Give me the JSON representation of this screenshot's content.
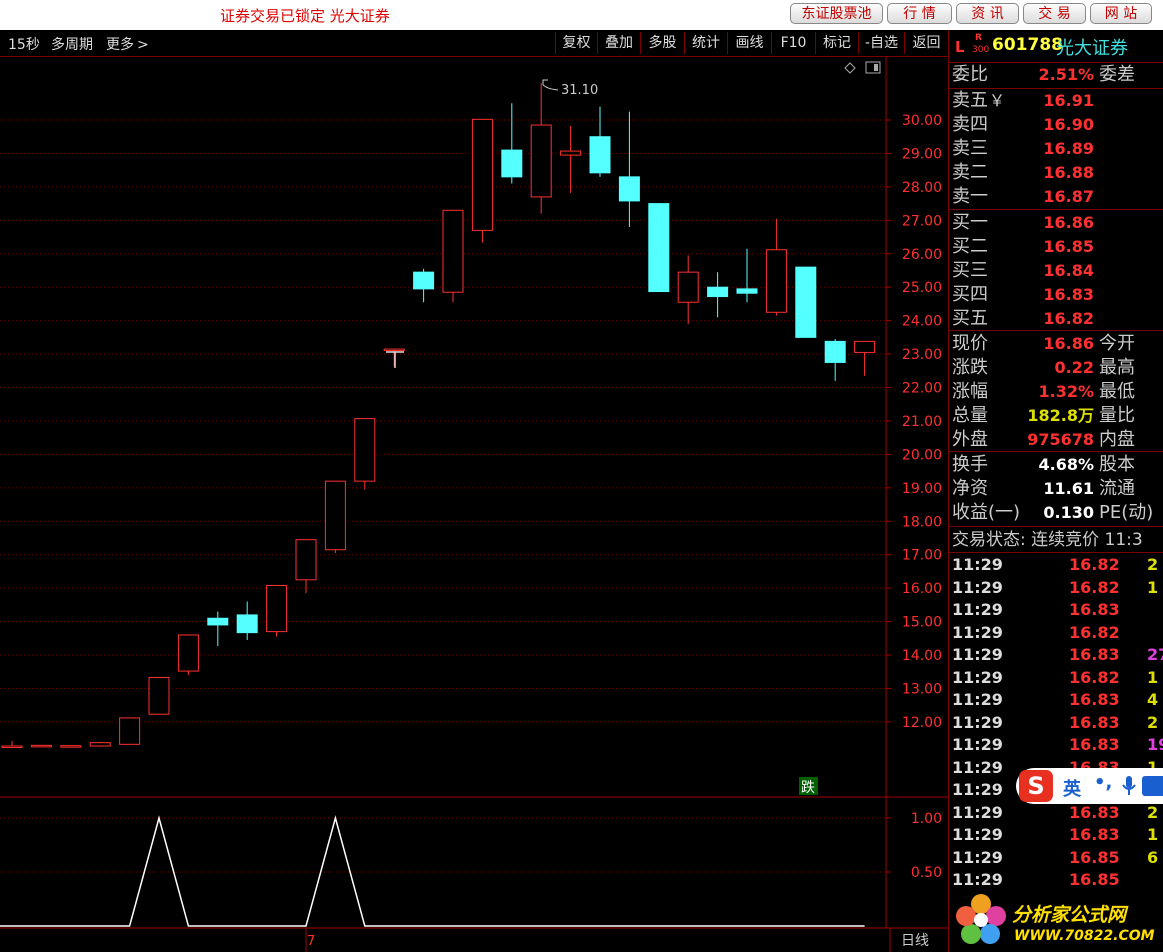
{
  "topbar": {
    "lock_message": "证券交易已锁定  光大证券",
    "buttons": [
      "东证股票池",
      "行 情",
      "资 讯",
      "交 易",
      "网 站"
    ]
  },
  "toolbar": {
    "period": "15秒",
    "multi_period": "多周期",
    "more": "更多",
    "buttons": [
      "复权",
      "叠加",
      "多股",
      "统计",
      "画线",
      "F10",
      "标记",
      "-自选",
      "返回"
    ]
  },
  "chart": {
    "high_marker": "31.10",
    "signal_label": "跌",
    "bottom_tab": "日线",
    "bottom_axis_label": "7"
  },
  "chart_data": [
    {
      "type": "candlestick",
      "y_ticks": [
        "30.00",
        "29.00",
        "28.00",
        "27.00",
        "26.00",
        "25.00",
        "24.00",
        "23.00",
        "22.00",
        "21.00",
        "20.00",
        "19.00",
        "18.00",
        "17.00",
        "16.00",
        "15.00",
        "14.00",
        "13.00",
        "12.00"
      ],
      "y_tick_values": [
        30,
        29,
        28,
        27,
        26,
        25,
        24,
        23,
        22,
        21,
        20,
        19,
        18,
        17,
        16,
        15,
        14,
        13,
        12
      ],
      "colors": {
        "up": "#ff3030",
        "down": "#54ffff"
      },
      "candles": [
        {
          "o": 11.28,
          "h": 11.43,
          "l": 11.28,
          "c": 11.28
        },
        {
          "o": 11.3,
          "h": 11.3,
          "l": 11.3,
          "c": 11.3
        },
        {
          "o": 11.29,
          "h": 11.29,
          "l": 11.29,
          "c": 11.29
        },
        {
          "o": 11.28,
          "h": 11.4,
          "l": 11.28,
          "c": 11.38
        },
        {
          "o": 11.33,
          "h": 12.12,
          "l": 11.33,
          "c": 12.12
        },
        {
          "o": 12.23,
          "h": 13.33,
          "l": 12.23,
          "c": 13.33
        },
        {
          "o": 13.52,
          "h": 14.6,
          "l": 13.4,
          "c": 14.6
        },
        {
          "o": 15.1,
          "h": 15.3,
          "l": 14.27,
          "c": 14.9
        },
        {
          "o": 15.2,
          "h": 15.6,
          "l": 14.45,
          "c": 14.67
        },
        {
          "o": 14.7,
          "h": 16.08,
          "l": 14.55,
          "c": 16.08
        },
        {
          "o": 16.25,
          "h": 17.45,
          "l": 15.85,
          "c": 17.45
        },
        {
          "o": 17.15,
          "h": 19.2,
          "l": 17.05,
          "c": 19.2
        },
        {
          "o": 19.2,
          "h": 21.07,
          "l": 18.95,
          "c": 21.07
        },
        {
          "o": 23.15,
          "h": 23.15,
          "l": 22.63,
          "c": 23.15
        },
        {
          "o": 25.45,
          "h": 25.55,
          "l": 24.55,
          "c": 24.95
        },
        {
          "o": 24.85,
          "h": 27.3,
          "l": 24.55,
          "c": 27.3
        },
        {
          "o": 26.7,
          "h": 30.02,
          "l": 26.33,
          "c": 30.02
        },
        {
          "o": 29.1,
          "h": 30.5,
          "l": 28.1,
          "c": 28.3
        },
        {
          "o": 27.7,
          "h": 31.1,
          "l": 27.2,
          "c": 29.85
        },
        {
          "o": 28.95,
          "h": 29.82,
          "l": 27.82,
          "c": 29.07
        },
        {
          "o": 29.5,
          "h": 30.4,
          "l": 28.3,
          "c": 28.42
        },
        {
          "o": 28.3,
          "h": 30.25,
          "l": 26.8,
          "c": 27.58
        },
        {
          "o": 27.5,
          "h": 27.5,
          "l": 24.87,
          "c": 24.87
        },
        {
          "o": 24.55,
          "h": 25.95,
          "l": 23.9,
          "c": 25.45
        },
        {
          "o": 25.0,
          "h": 25.45,
          "l": 24.1,
          "c": 24.72
        },
        {
          "o": 24.95,
          "h": 26.15,
          "l": 24.55,
          "c": 24.82
        },
        {
          "o": 24.25,
          "h": 27.05,
          "l": 24.15,
          "c": 26.12
        },
        {
          "o": 25.6,
          "h": 25.6,
          "l": 23.5,
          "c": 23.5
        },
        {
          "o": 23.38,
          "h": 23.45,
          "l": 22.2,
          "c": 22.75
        },
        {
          "o": 23.05,
          "h": 23.38,
          "l": 22.35,
          "c": 23.38
        }
      ]
    },
    {
      "type": "line",
      "y_ticks": [
        "1.00",
        "0.50"
      ],
      "y_tick_values": [
        1.0,
        0.5
      ],
      "series": [
        {
          "points": [
            [
              0,
              0
            ],
            [
              4,
              0
            ],
            [
              5,
              1
            ],
            [
              6,
              0
            ],
            [
              10,
              0
            ],
            [
              11,
              1
            ],
            [
              12,
              0
            ],
            [
              29,
              0
            ]
          ]
        }
      ]
    }
  ],
  "quote": {
    "badge_l": "L",
    "badge_r": "R",
    "badge_300": "300",
    "code": "601788",
    "name": "光大证券",
    "weibi_label": "委比",
    "weibi_value": "2.51%",
    "weicha_label": "委差",
    "sell": [
      {
        "label": "卖五",
        "price": "16.91"
      },
      {
        "label": "卖四",
        "price": "16.90"
      },
      {
        "label": "卖三",
        "price": "16.89"
      },
      {
        "label": "卖二",
        "price": "16.88"
      },
      {
        "label": "卖一",
        "price": "16.87"
      }
    ],
    "sell5_mark": "￥",
    "buy": [
      {
        "label": "买一",
        "price": "16.86"
      },
      {
        "label": "买二",
        "price": "16.85"
      },
      {
        "label": "买三",
        "price": "16.84"
      },
      {
        "label": "买四",
        "price": "16.83"
      },
      {
        "label": "买五",
        "price": "16.82"
      }
    ],
    "stats1": [
      {
        "label": "现价",
        "value": "16.86",
        "label2": "今开",
        "color": "#ff3030"
      },
      {
        "label": "涨跌",
        "value": "0.22",
        "label2": "最高",
        "color": "#ff3030"
      },
      {
        "label": "涨幅",
        "value": "1.32%",
        "label2": "最低",
        "color": "#ff3030"
      },
      {
        "label": "总量",
        "value": "182.8万",
        "label2": "量比",
        "color": "#e0e000"
      },
      {
        "label": "外盘",
        "value": "975678",
        "label2": "内盘",
        "color": "#ff3030"
      }
    ],
    "stats2": [
      {
        "label": "换手",
        "value": "4.68%",
        "label2": "股本",
        "color": "#ffffff"
      },
      {
        "label": "净资",
        "value": "11.61",
        "label2": "流通",
        "color": "#ffffff"
      },
      {
        "label": "收益(一)",
        "value": "0.130",
        "label2": "PE(动)",
        "color": "#ffffff"
      }
    ],
    "trade_status": "交易状态: 连续竞价 11:3",
    "ticks": [
      {
        "time": "11:29",
        "price": "16.82",
        "vol": "2",
        "vc": "#e0e000"
      },
      {
        "time": "11:29",
        "price": "16.82",
        "vol": "1",
        "vc": "#e0e000"
      },
      {
        "time": "11:29",
        "price": "16.83",
        "vol": "",
        "vc": "#e0e000"
      },
      {
        "time": "11:29",
        "price": "16.82",
        "vol": "",
        "vc": "#e0e000"
      },
      {
        "time": "11:29",
        "price": "16.83",
        "vol": "27",
        "vc": "#e040e0"
      },
      {
        "time": "11:29",
        "price": "16.82",
        "vol": "1",
        "vc": "#e0e000"
      },
      {
        "time": "11:29",
        "price": "16.83",
        "vol": "4",
        "vc": "#e0e000"
      },
      {
        "time": "11:29",
        "price": "16.83",
        "vol": "2",
        "vc": "#e0e000"
      },
      {
        "time": "11:29",
        "price": "16.83",
        "vol": "19",
        "vc": "#e040e0"
      },
      {
        "time": "11:29",
        "price": "16.83",
        "vol": "1",
        "vc": "#e0e000"
      },
      {
        "time": "11:29",
        "price": "16.82",
        "vol": "",
        "vc": "#e0e000"
      },
      {
        "time": "11:29",
        "price": "16.83",
        "vol": "2",
        "vc": "#e0e000"
      },
      {
        "time": "11:29",
        "price": "16.83",
        "vol": "1",
        "vc": "#e0e000"
      },
      {
        "time": "11:29",
        "price": "16.85",
        "vol": "6",
        "vc": "#e0e000"
      },
      {
        "time": "11:29",
        "price": "16.85",
        "vol": "",
        "vc": "#e0e000"
      }
    ]
  },
  "ime": {
    "logo": "S",
    "mode": "英",
    "punct": "•,"
  },
  "watermark": {
    "title": "分析家公式网",
    "url": "WWW.70822.COM"
  }
}
